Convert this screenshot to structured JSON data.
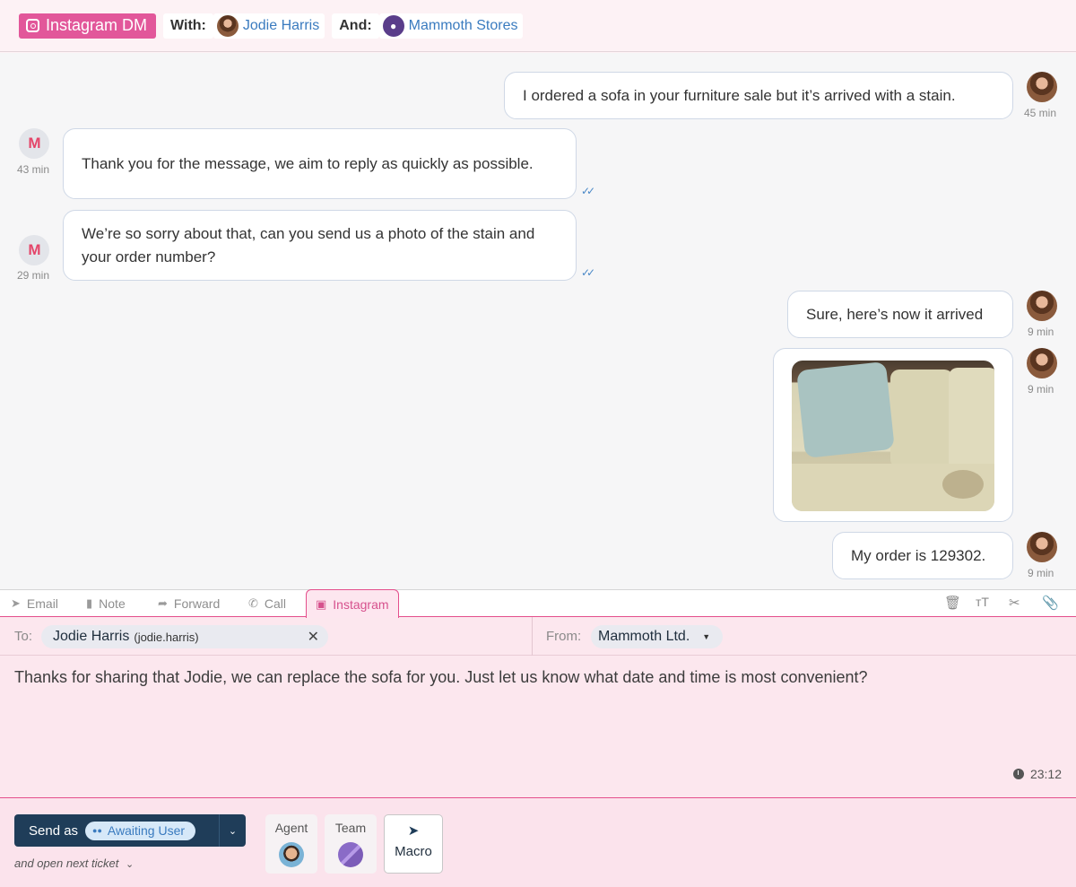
{
  "header": {
    "channel_label": "Instagram DM",
    "with_label": "With:",
    "with_name": "Jodie Harris",
    "and_label": "And:",
    "and_name": "Mammoth Stores"
  },
  "messages": [
    {
      "sender": "customer",
      "text": "I ordered a sofa in your furniture sale but it’s arrived with a stain.",
      "time": "45 min"
    },
    {
      "sender": "brand",
      "text": "Thank you for the message, we aim to reply as quickly as possible.",
      "time": "43 min",
      "read": true
    },
    {
      "sender": "brand",
      "text": "We’re so sorry about that, can you send us a photo of the stain and your order number?",
      "time": "29 min",
      "read": true
    },
    {
      "sender": "customer",
      "text": "Sure, here’s now it arrived",
      "time": "9 min"
    },
    {
      "sender": "customer",
      "type": "image",
      "time": "9 min"
    },
    {
      "sender": "customer",
      "text": "My order is 129302.",
      "time": "9 min"
    }
  ],
  "composer": {
    "tabs": [
      {
        "label": "Email",
        "icon": "paper-plane-icon"
      },
      {
        "label": "Note",
        "icon": "document-icon"
      },
      {
        "label": "Forward",
        "icon": "forward-arrow-icon"
      },
      {
        "label": "Call",
        "icon": "phone-icon"
      },
      {
        "label": "Instagram",
        "icon": "instagram-icon",
        "active": true
      }
    ],
    "tools": [
      "trash-icon",
      "text-size-icon",
      "scissors-icon",
      "paperclip-icon"
    ],
    "to_label": "To:",
    "to_name": "Jodie Harris",
    "to_handle": "(jodie.harris)",
    "from_label": "From:",
    "from_value": "Mammoth Ltd.",
    "body": "Thanks for sharing that Jodie, we can replace the sofa for you. Just let us know what date and time is most convenient?",
    "timer": "23:12"
  },
  "footer": {
    "send_label": "Send as",
    "status": "Awaiting User",
    "next_ticket": "and open next ticket",
    "agent_label": "Agent",
    "team_label": "Team",
    "macro_label": "Macro"
  },
  "colors": {
    "accent_pink": "#e2579a",
    "link_blue": "#3a7bbf",
    "send_navy": "#1f3d59"
  }
}
